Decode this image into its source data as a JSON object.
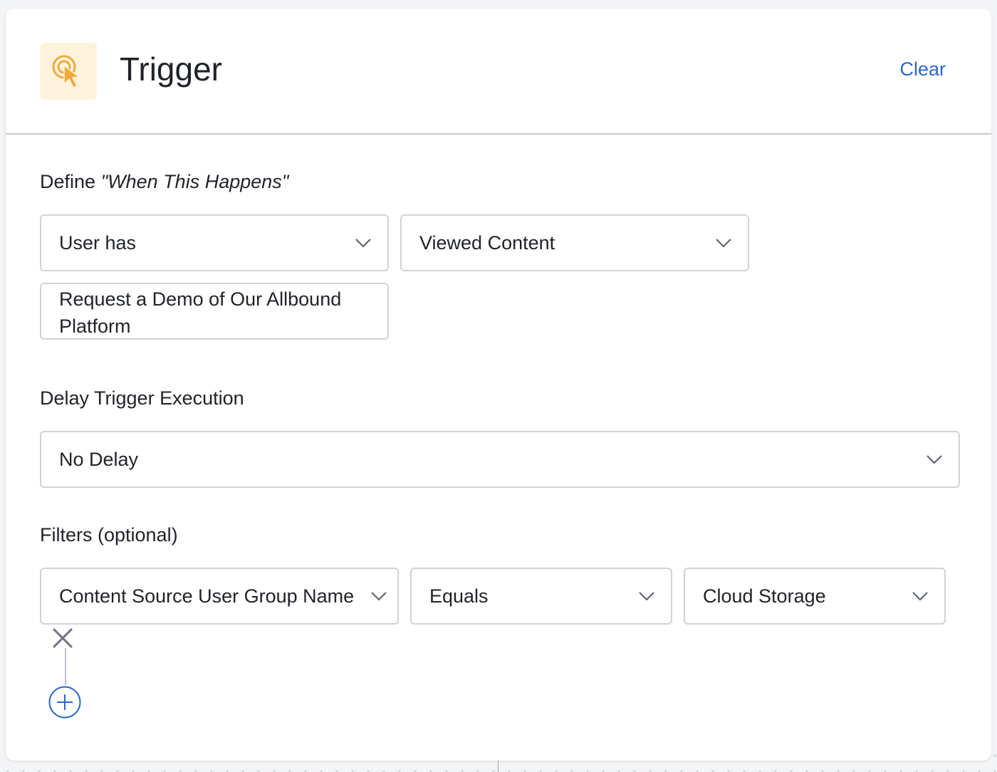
{
  "header": {
    "title": "Trigger",
    "clear_label": "Clear",
    "icon": "cursor-click-icon"
  },
  "define": {
    "label_prefix": "Define ",
    "label_quote": "\"When This Happens\"",
    "subject_select": "User has",
    "action_select": "Viewed Content",
    "content_value": "Request a Demo of Our Allbound Platform"
  },
  "delay": {
    "label": "Delay Trigger Execution",
    "value": "No Delay"
  },
  "filters": {
    "label": "Filters (optional)",
    "rows": [
      {
        "field": "Content Source User Group Name",
        "operator": "Equals",
        "value": "Cloud Storage"
      }
    ]
  },
  "colors": {
    "accent": "#2f67c9",
    "icon_orange": "#f2a93b",
    "icon_bg": "#fdf3dc",
    "border": "#cfd3d8"
  }
}
